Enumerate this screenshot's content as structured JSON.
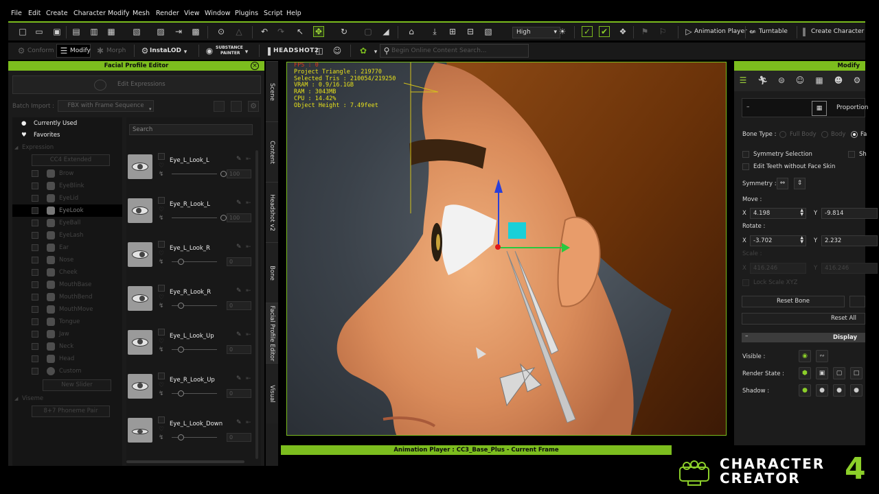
{
  "menu": [
    "File",
    "Edit",
    "Create",
    "Character",
    "Modify",
    "Mesh",
    "Render",
    "View",
    "Window",
    "Plugins",
    "Script",
    "Help"
  ],
  "toolbar": {
    "quality": "High",
    "animation_player": "Animation Player",
    "turntable": "Turntable",
    "create_character": "Create Character"
  },
  "toolbar2": {
    "conform": "Conform",
    "modify": "Modify",
    "morph": "Morph",
    "instalod": "InstaLOD",
    "substance": "SUBSTANCE",
    "painter": "PAINTER",
    "headshot": "HEADSHOT2",
    "search_placeholder": "Begin Online Content Search..."
  },
  "left_panel": {
    "title": "Facial Profile Editor",
    "edit_expressions": "Edit Expressions",
    "batch_import": "Batch Import :",
    "fbx_option": "FBX with Frame Sequence",
    "currently_used": "Currently Used",
    "favorites": "Favorites",
    "expression": "Expression",
    "cc4_extended": "CC4 Extended",
    "categories": [
      "Brow",
      "EyeBlink",
      "EyeLid",
      "EyeLook",
      "EyeBall",
      "EyeLash",
      "Ear",
      "Nose",
      "Cheek",
      "MouthBase",
      "MouthBend",
      "MouthMove",
      "Tongue",
      "Jaw",
      "Neck",
      "Head",
      "Custom"
    ],
    "new_slider": "New Slider",
    "viseme": "Viseme",
    "phoneme": "8+7 Phoneme Pair",
    "search_placeholder": "Search",
    "sliders": [
      {
        "name": "Eye_L_Look_L",
        "value": "100"
      },
      {
        "name": "Eye_R_Look_L",
        "value": "100"
      },
      {
        "name": "Eye_L_Look_R",
        "value": "0"
      },
      {
        "name": "Eye_R_Look_R",
        "value": "0"
      },
      {
        "name": "Eye_L_Look_Up",
        "value": "0"
      },
      {
        "name": "Eye_R_Look_Up",
        "value": "0"
      },
      {
        "name": "Eye_L_Look_Down",
        "value": "0"
      }
    ]
  },
  "vtabs": [
    "Scene",
    "Content",
    "Headshot v2",
    "Bone",
    "Facial Profile Editor",
    "Visual"
  ],
  "stats": [
    "FPS : 0",
    "Project Triangle : 219770",
    "Selected Tris : 210054/219250",
    "VRAM : 0.9/16.1GB",
    "RAM : 3043MB",
    "CPU : 14.42%",
    "Object Height : 7.49feet"
  ],
  "animation_bar": "Animation Player : CC3_Base_Plus - Current Frame",
  "right_panel": {
    "title": "Modify",
    "proportion": "Proportion",
    "bone_type": "Bone Type :",
    "full_body": "Full Body",
    "body": "Body",
    "face": "Fa",
    "symmetry_selection": "Symmetry Selection",
    "sh": "Sh",
    "edit_teeth": "Edit Teeth without Face Skin",
    "symmetry": "Symmetry :",
    "move": "Move :",
    "move_x": "4.198",
    "move_y": "-9.814",
    "rotate": "Rotate :",
    "rotate_x": "-3.702",
    "rotate_y": "2.232",
    "scale": "Scale :",
    "scale_x": "416.246",
    "scale_y": "416.246",
    "lock_scale": "Lock Scale XYZ",
    "reset_bone": "Reset Bone",
    "reset_all": "Reset All",
    "display": "Display",
    "visible": "Visible :",
    "render_state": "Render State :",
    "shadow": "Shadow :",
    "x": "X",
    "y": "Y"
  },
  "logo": {
    "line1": "CHARACTER",
    "line2": "CREATOR",
    "version": "4"
  },
  "colors": {
    "accent": "#7cbd1e",
    "stats": "#e8e21b"
  }
}
